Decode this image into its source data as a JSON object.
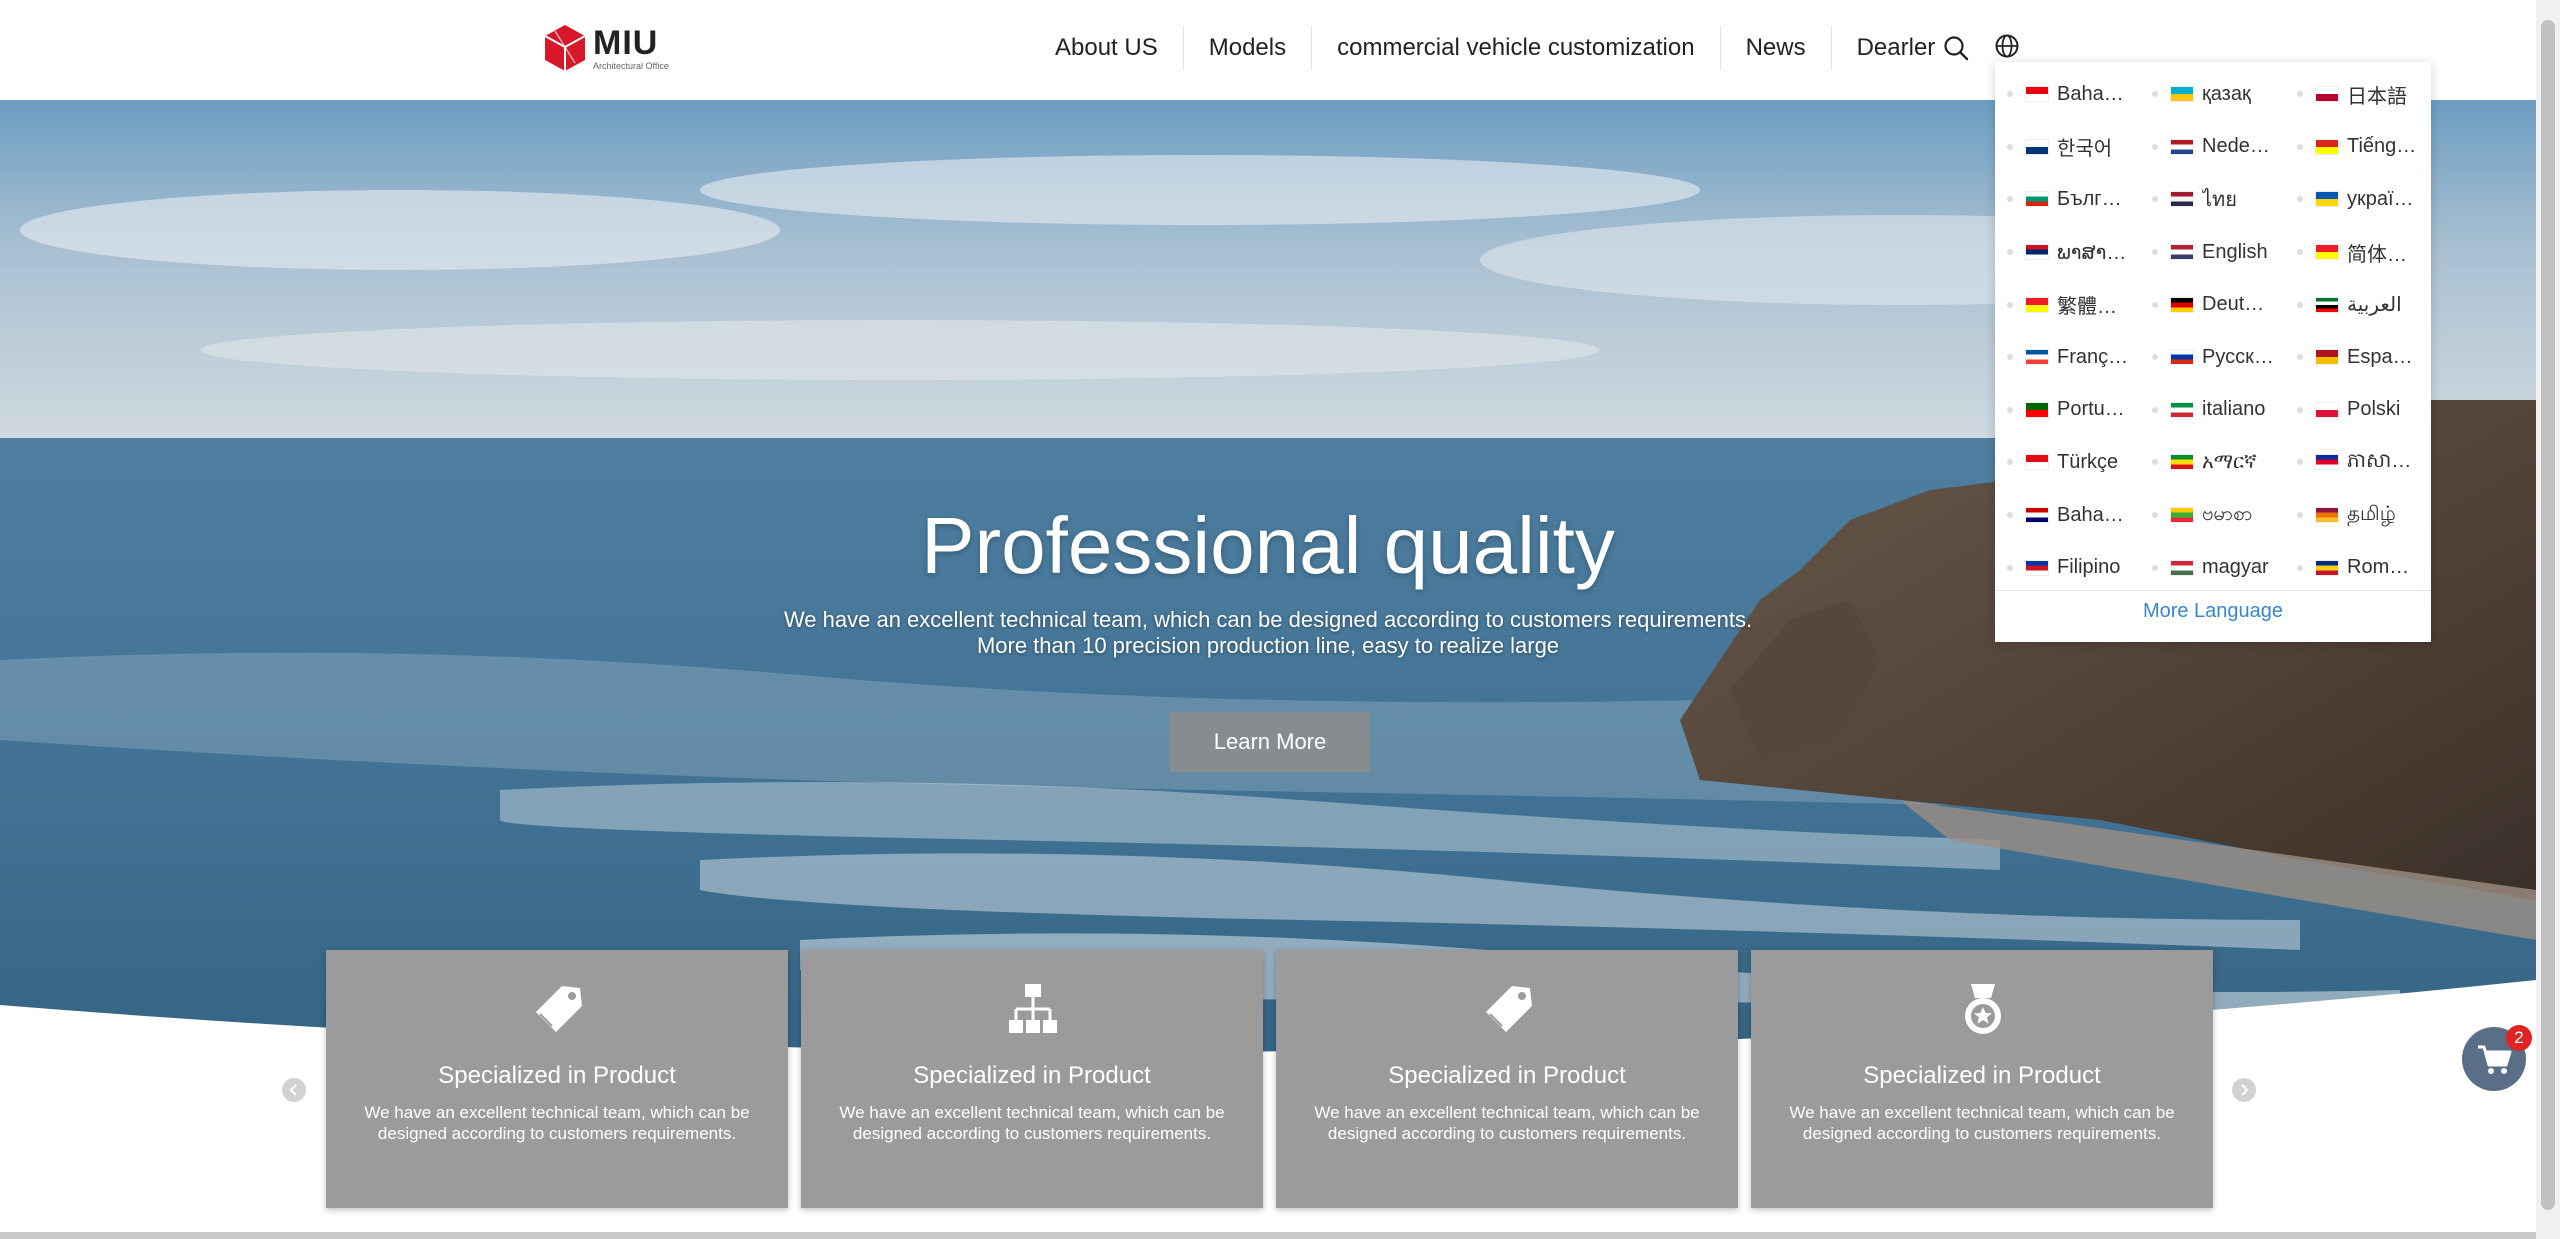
{
  "brand": {
    "name": "MIU",
    "tagline": "Architectural Office",
    "color": "#d7182a"
  },
  "nav": [
    {
      "label": "About US"
    },
    {
      "label": "Models"
    },
    {
      "label": "commercial vehicle customization"
    },
    {
      "label": "News"
    },
    {
      "label": "Dearler"
    }
  ],
  "icons": {
    "search": "search-icon",
    "language": "globe-icon",
    "cart": "cart-icon"
  },
  "hero": {
    "title": "Professional quality",
    "line1": "We have an excellent technical team, which can be designed according to customers requirements.",
    "line2": "More than 10 precision production line, easy to realize large",
    "button": "Learn More"
  },
  "cards": [
    {
      "icon": "tag-icon",
      "title": "Specialized in Product",
      "line1": "We have an excellent technical team, which can be",
      "line2": "designed according to customers requirements."
    },
    {
      "icon": "sitemap-icon",
      "title": "Specialized in Product",
      "line1": "We have an excellent technical team, which can be",
      "line2": "designed according to customers requirements."
    },
    {
      "icon": "tag-icon",
      "title": "Specialized in Product",
      "line1": "We have an excellent technical team, which can be",
      "line2": "designed according to customers requirements."
    },
    {
      "icon": "medal-icon",
      "title": "Specialized in Product",
      "line1": "We have an excellent technical team, which can be",
      "line2": "designed according to customers requirements."
    }
  ],
  "languages": [
    {
      "name": "Baha…",
      "flag": [
        "#e70011",
        "#ffffff"
      ]
    },
    {
      "name": "қазақ",
      "flag": [
        "#00afca",
        "#fec50c"
      ]
    },
    {
      "name": "日本語",
      "flag": [
        "#ffffff",
        "#bc002d"
      ]
    },
    {
      "name": "한국어",
      "flag": [
        "#ffffff",
        "#003478"
      ]
    },
    {
      "name": "Nede…",
      "flag": [
        "#ae1c28",
        "#ffffff",
        "#21468b"
      ]
    },
    {
      "name": "Tiếng…",
      "flag": [
        "#da251d",
        "#ffff00"
      ]
    },
    {
      "name": "Бълг…",
      "flag": [
        "#ffffff",
        "#00966e",
        "#d62612"
      ]
    },
    {
      "name": "ไทย",
      "flag": [
        "#a51931",
        "#f4f5f8",
        "#2d2a4a"
      ]
    },
    {
      "name": "украї…",
      "flag": [
        "#0057b7",
        "#ffd700"
      ]
    },
    {
      "name": "ພາສາ…",
      "flag": [
        "#ce1126",
        "#002868",
        "#ffffff"
      ]
    },
    {
      "name": "English",
      "flag": [
        "#b22234",
        "#ffffff",
        "#3c3b6e"
      ]
    },
    {
      "name": "简体…",
      "flag": [
        "#ee1c25",
        "#ffff00"
      ]
    },
    {
      "name": "繁體…",
      "flag": [
        "#ee1c25",
        "#ffff00"
      ]
    },
    {
      "name": "Deut…",
      "flag": [
        "#000000",
        "#dd0000",
        "#ffce00"
      ]
    },
    {
      "name": "العربية",
      "flag": [
        "#00732f",
        "#ffffff",
        "#000000",
        "#ff0000"
      ]
    },
    {
      "name": "Franç…",
      "flag": [
        "#0055a4",
        "#ffffff",
        "#ef4135"
      ]
    },
    {
      "name": "Русск…",
      "flag": [
        "#ffffff",
        "#0039a6",
        "#d52b1e"
      ]
    },
    {
      "name": "Espa…",
      "flag": [
        "#aa151b",
        "#f1bf00"
      ]
    },
    {
      "name": "Portu…",
      "flag": [
        "#006600",
        "#ff0000"
      ]
    },
    {
      "name": "italiano",
      "flag": [
        "#009246",
        "#ffffff",
        "#ce2b37"
      ]
    },
    {
      "name": "Polski",
      "flag": [
        "#ffffff",
        "#dc143c"
      ]
    },
    {
      "name": "Türkçe",
      "flag": [
        "#e30a17",
        "#ffffff"
      ]
    },
    {
      "name": "አማርኛ",
      "flag": [
        "#078930",
        "#fcdd09",
        "#da121a"
      ]
    },
    {
      "name": "ភាសា…",
      "flag": [
        "#032ea1",
        "#e00025",
        "#ffffff"
      ]
    },
    {
      "name": "Baha…",
      "flag": [
        "#cc0001",
        "#ffffff",
        "#010066"
      ]
    },
    {
      "name": "ဗမာစာ",
      "flag": [
        "#fecb00",
        "#34b233",
        "#ea2839"
      ]
    },
    {
      "name": "தமிழ்",
      "flag": [
        "#8d153a",
        "#eb7400",
        "#ffbe29"
      ]
    },
    {
      "name": "Filipino",
      "flag": [
        "#0038a8",
        "#ce1126",
        "#ffffff"
      ]
    },
    {
      "name": "magyar",
      "flag": [
        "#ce2939",
        "#ffffff",
        "#477050"
      ]
    },
    {
      "name": "Rom…",
      "flag": [
        "#002b7f",
        "#fcd116",
        "#ce1126"
      ]
    }
  ],
  "more_language": "More Language",
  "cart_count": "2"
}
